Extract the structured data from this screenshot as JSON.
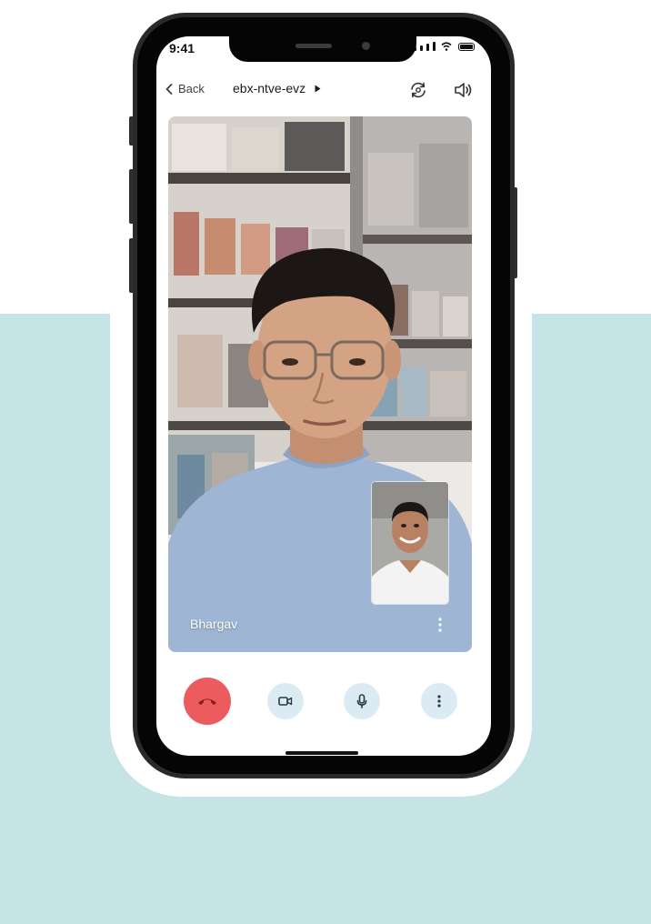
{
  "status_bar": {
    "time": "9:41",
    "signal_icon": "cellular-signal-icon",
    "wifi_icon": "wifi-icon",
    "battery_icon": "battery-icon"
  },
  "top_bar": {
    "back_label": "Back",
    "back_icon": "chevron-left-icon",
    "room_name": "ebx-ntve-evz",
    "room_menu_icon": "caret-right-icon",
    "switch_camera_icon": "switch-camera-icon",
    "speaker_icon": "speaker-icon"
  },
  "main_video": {
    "participant_name": "Bhargav",
    "menu_icon": "more-vertical-icon"
  },
  "self_view": {
    "description_icon": "self-view-thumbnail"
  },
  "controls": {
    "end_call_icon": "hang-up-icon",
    "camera_icon": "video-camera-icon",
    "mic_icon": "microphone-icon",
    "more_icon": "more-vertical-icon"
  },
  "colors": {
    "background_band": "#c6e3e5",
    "end_call": "#ec5b5d",
    "control_button": "#dcebf3",
    "shirt_main": "#9fb5d4",
    "shirt_pip": "#f3f3f3"
  }
}
